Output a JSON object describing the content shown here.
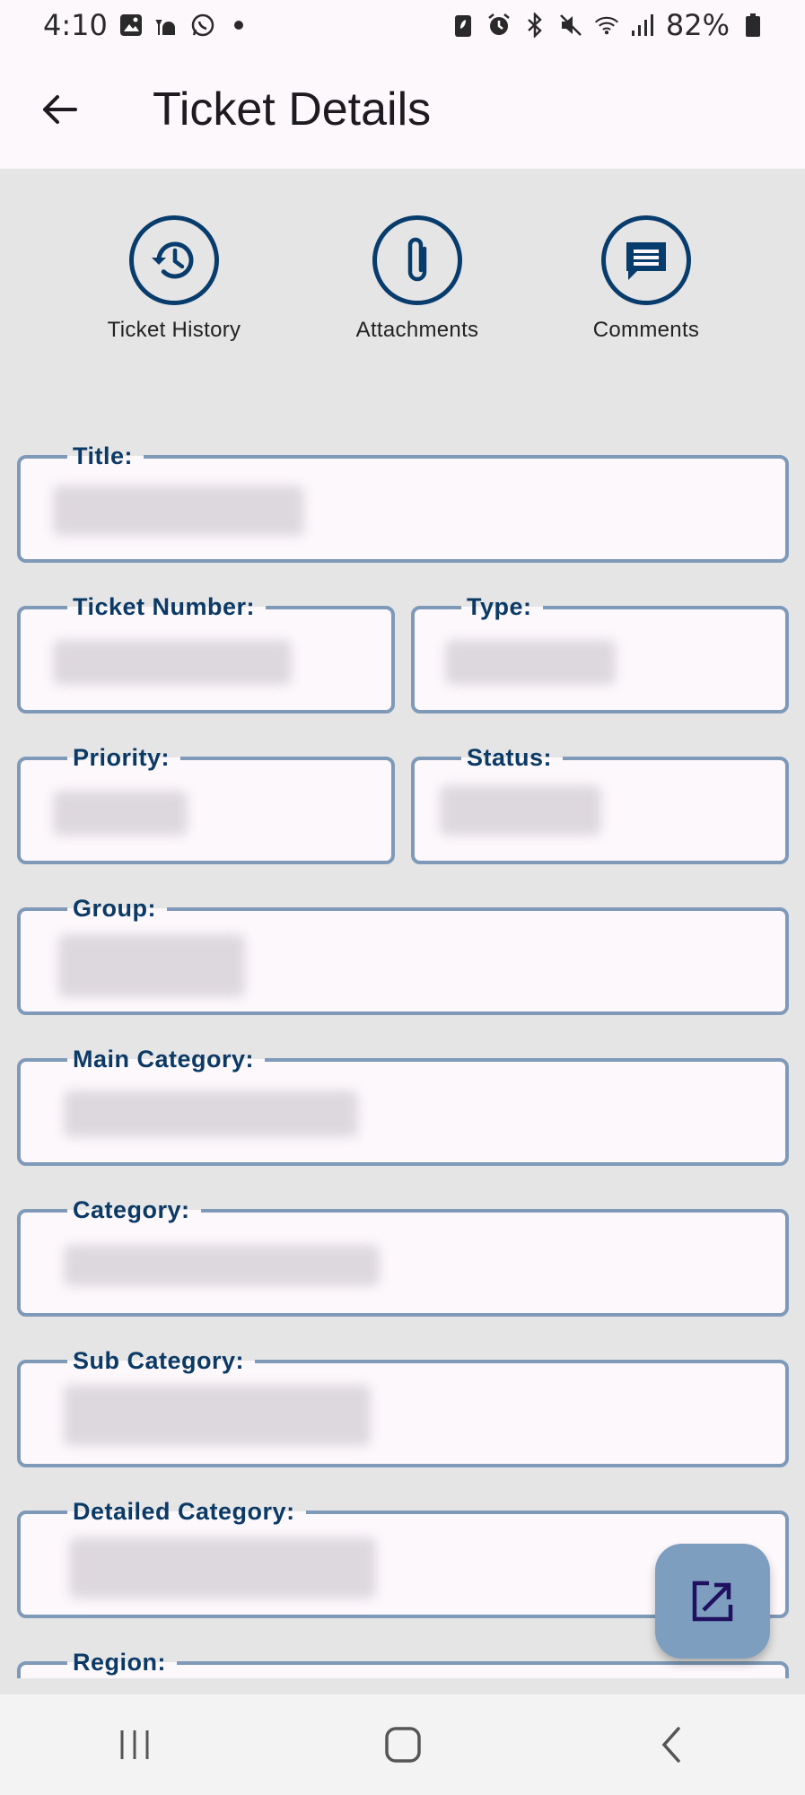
{
  "status_bar": {
    "time": "4:10",
    "battery": "82%"
  },
  "app_bar": {
    "title": "Ticket Details"
  },
  "actions": [
    {
      "label": "Ticket History",
      "icon": "history-icon"
    },
    {
      "label": "Attachments",
      "icon": "paperclip-icon"
    },
    {
      "label": "Comments",
      "icon": "comment-icon"
    }
  ],
  "fields": {
    "title": "Title:",
    "ticket_number": "Ticket Number:",
    "type": "Type:",
    "priority": "Priority:",
    "status": "Status:",
    "group": "Group:",
    "main_category": "Main Category:",
    "category": "Category:",
    "sub_category": "Sub Category:",
    "detailed_category": "Detailed Category:",
    "region": "Region:"
  },
  "colors": {
    "accent": "#083c6c",
    "field_border": "#7f9ab8",
    "fab": "#7e9ebf",
    "background": "#e5e5e5"
  }
}
